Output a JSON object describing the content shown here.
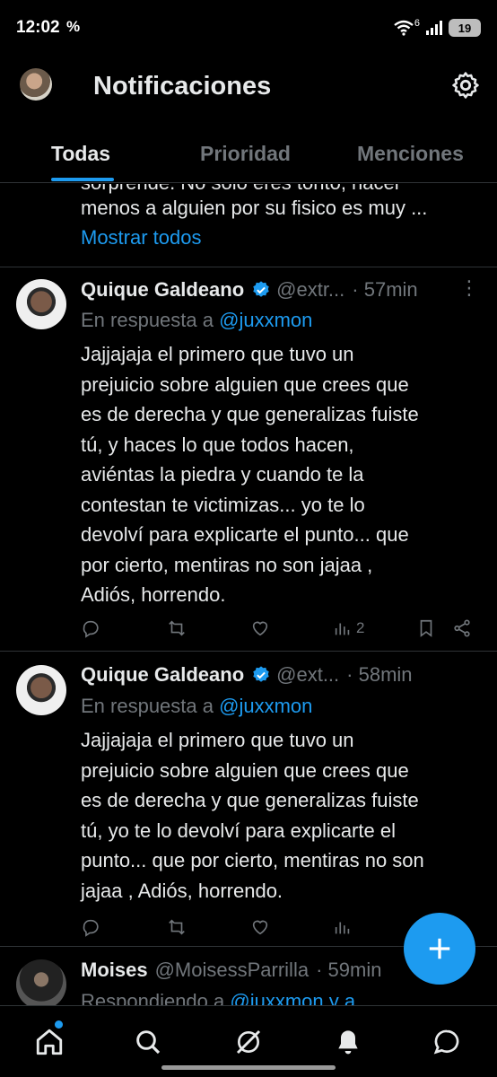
{
  "status": {
    "time": "12:02",
    "app_glyph": "%",
    "network": "6",
    "battery": "19"
  },
  "header": {
    "title": "Notificaciones"
  },
  "tabs": [
    {
      "label": "Todas",
      "active": true
    },
    {
      "label": "Prioridad",
      "active": false
    },
    {
      "label": "Menciones",
      "active": false
    }
  ],
  "partial": {
    "top_line": "sorprende. No solo eres tonto, hacer",
    "text": "menos a alguien por su fisico es muy ...",
    "show_all": "Mostrar todos"
  },
  "tweets": [
    {
      "name": "Quique Galdeano",
      "handle": "@extr...",
      "time": "· 57min",
      "reply_prefix": "En respuesta a ",
      "reply_mention": "@juxxmon",
      "lines": [
        "Jajjajaja el primero que tuvo un",
        "prejuicio sobre alguien que crees que",
        "es de derecha y que generalizas fuiste",
        "tú, y haces lo que todos hacen,",
        "aviéntas la piedra y cuando te la",
        "contestan te victimizas... yo te lo",
        "devolví para explicarte el punto... que",
        "por cierto, mentiras no son jajaa ,",
        "Adiós, horrendo."
      ],
      "views": "2"
    },
    {
      "name": "Quique Galdeano",
      "handle": "@ext...",
      "time": "· 58min",
      "reply_prefix": "En respuesta a ",
      "reply_mention": "@juxxmon",
      "lines": [
        "Jajjajaja el primero que tuvo un",
        "prejuicio sobre alguien que crees que",
        "es de derecha y que generalizas fuiste",
        "tú, yo te lo devolví para explicarte el",
        "punto... que por cierto, mentiras no son",
        "jajaa , Adiós, horrendo."
      ],
      "views": ""
    },
    {
      "name": "Moises",
      "handle": "@MoisessParrilla",
      "time": "· 59min",
      "reply_prefix": "Respondiendo a ",
      "reply_mention": "@juxxmon y a"
    }
  ],
  "colors": {
    "accent": "#1d9bf0",
    "muted": "#71767b",
    "text": "#e7e9ea",
    "divider": "#2f3336"
  }
}
